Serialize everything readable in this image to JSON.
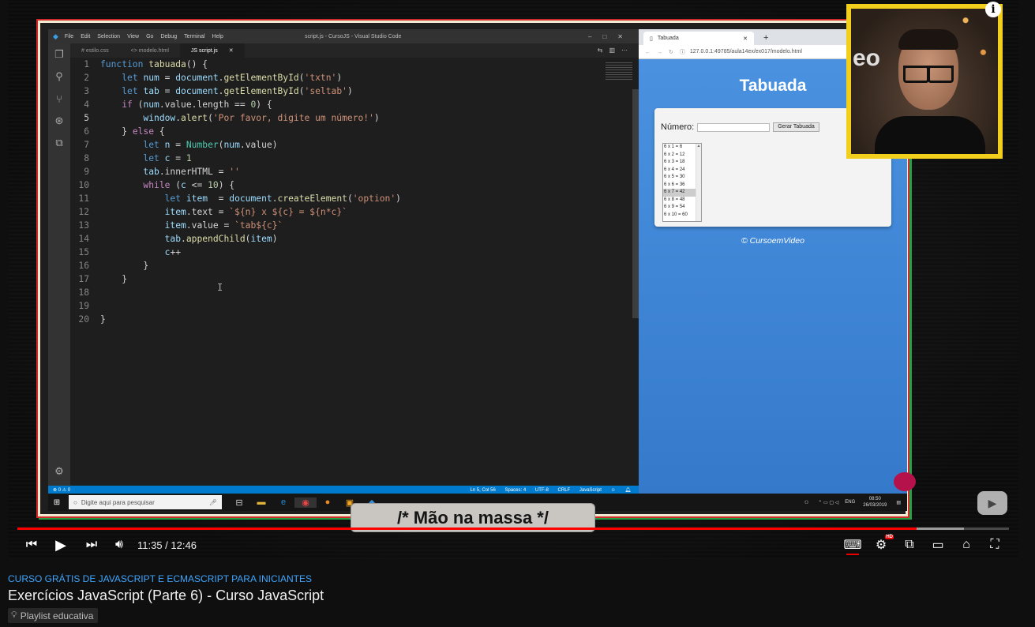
{
  "vscode": {
    "menu": [
      "File",
      "Edit",
      "Selection",
      "View",
      "Go",
      "Debug",
      "Terminal",
      "Help"
    ],
    "window_title": "script.js - CursoJS - Visual Studio Code",
    "tabs": [
      {
        "label": "# estilo.css"
      },
      {
        "label": "<> modelo.html"
      },
      {
        "label": "JS script.js"
      }
    ],
    "current_line": 5,
    "code_lines": [
      "function tabuada() {",
      "    let num = document.getElementById('txtn')",
      "    let tab = document.getElementById('seltab')",
      "    if (num.value.length == 0) {",
      "        window.alert('Por favor, digite um número!')",
      "    } else {",
      "        let n = Number(num.value)",
      "        let c = 1",
      "        tab.innerHTML = ''",
      "        while (c <= 10) {",
      "            let item  = document.createElement('option')",
      "            item.text = `${n} x ${c} = ${n*c}`",
      "            item.value = `tab${c}`",
      "            tab.appendChild(item)",
      "            c++",
      "        }",
      "    }",
      "",
      "",
      "}"
    ],
    "status": {
      "left": "⊗ 0 ⚠ 0",
      "position": "Ln 5, Col 56",
      "spaces": "Spaces: 4",
      "encoding": "UTF-8",
      "eol": "CRLF",
      "language": "JavaScript"
    }
  },
  "browser": {
    "tab_title": "Tabuada",
    "url": "127.0.0.1:49785/aula14ex/ex017/modelo.html",
    "page_title": "Tabuada",
    "numero_label": "Número:",
    "button_label": "Gerar Tabuada",
    "options": [
      "6 x 1 = 6",
      "6 x 2 = 12",
      "6 x 3 = 18",
      "6 x 4 = 24",
      "6 x 5 = 30",
      "6 x 6 = 36",
      "6 x 7 = 42",
      "6 x 8 = 48",
      "6 x 9 = 54",
      "6 x 10 = 60"
    ],
    "selected_option": 6,
    "footer": "© CursoemVideo"
  },
  "taskbar": {
    "search_placeholder": "Digite aqui para pesquisar",
    "lang": "ENG",
    "time": "08:50",
    "date": "26/03/2019"
  },
  "overlay": {
    "caption": "/* Mão na massa */",
    "cam_text": "eo"
  },
  "player": {
    "current_time": "11:35",
    "duration": "12:46",
    "time_display": "11:35 / 12:46",
    "progress_fraction": 0.907,
    "buffered_fraction": 0.955,
    "quality_badge": "HD",
    "accent_color": "#ff0000"
  },
  "video": {
    "playlist_tag": "CURSO GRÁTIS DE JAVASCRIPT E ECMASCRIPT PARA INICIANTES",
    "title": "Exercícios JavaScript (Parte 6) - Curso JavaScript",
    "badge": "Playlist educativa"
  }
}
